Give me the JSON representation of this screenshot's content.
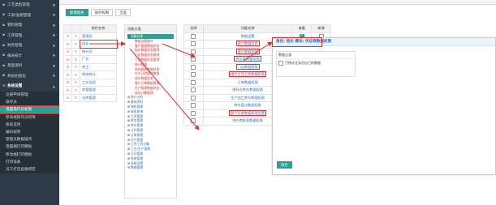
{
  "sidebar": {
    "items": [
      {
        "label": "工艺类别管理",
        "icon": "list-icon"
      },
      {
        "label": "工资/准假管理",
        "icon": "list-icon"
      },
      {
        "label": "物料管理",
        "icon": "box-icon"
      },
      {
        "label": "工序管理",
        "icon": "cog-icon"
      },
      {
        "label": "财务管理",
        "icon": "money-icon"
      },
      {
        "label": "报表统计",
        "icon": "chart-icon"
      },
      {
        "label": "基础资料",
        "icon": "database-icon"
      },
      {
        "label": "系统初始化",
        "icon": "wrench-icon"
      }
    ],
    "settings_label": "系统设置",
    "sub_items": [
      "注册申请管理",
      "操作员",
      "电脑操作员权限",
      "移动端操作员权限",
      "系统选项",
      "编码规则",
      "管理员数据操作",
      "电脑端打印模板",
      "移动端打印模板",
      "打印设备",
      "员工打包设备绑定"
    ],
    "active_sub_index": 2
  },
  "toolbar": {
    "new_label": "新增角色",
    "save_label": "保存权限",
    "all_label": "全选"
  },
  "roles": {
    "header": "角色名称",
    "rows": [
      "管理员",
      "组长",
      "统计员",
      "厂长",
      "质工",
      "财务统计",
      "工艺员组",
      "库管管理",
      "仓库管理"
    ],
    "selected_index": 1
  },
  "categories": {
    "header": "功能分类",
    "nodes": [
      {
        "label": "功能分类",
        "level": 0,
        "selected": true
      },
      {
        "label": "数据设置操作",
        "level": 1
      },
      {
        "label": "客户管理数据状态",
        "level": 1
      },
      {
        "label": "报价数据状态管理",
        "level": 1
      },
      {
        "label": "门店数据状态管理",
        "level": 1
      },
      {
        "label": "工序数据状态管理",
        "level": 1
      },
      {
        "label": "统计数据",
        "level": 1
      },
      {
        "label": "库存管理数据状态",
        "level": 1
      },
      {
        "label": "生产计划操作数据",
        "level": 1
      },
      {
        "label": "成本数据状态",
        "level": 1
      },
      {
        "label": "客户订单数据管理",
        "level": 1
      },
      {
        "label": "生产管理数据状态",
        "level": 1
      },
      {
        "label": "成本计算管理",
        "level": 1
      },
      {
        "label": "统计分析",
        "level": 0
      },
      {
        "label": "基础资料",
        "level": 0
      },
      {
        "label": "物料管理",
        "level": 0
      },
      {
        "label": "报表查询",
        "level": 0
      },
      {
        "label": "工资管理",
        "level": 0
      },
      {
        "label": "财务管理",
        "level": 0
      },
      {
        "label": "库存管理",
        "level": 0
      },
      {
        "label": "计件管理",
        "level": 0
      },
      {
        "label": "订单管理",
        "level": 0
      },
      {
        "label": "生产管理",
        "level": 0
      },
      {
        "label": "工序工资计算",
        "level": 0
      },
      {
        "label": "工艺/生产管理",
        "level": 0
      },
      {
        "label": "打印管理",
        "level": 0
      },
      {
        "label": "系统管理",
        "level": 0
      },
      {
        "label": "系统设置",
        "level": 0
      },
      {
        "label": "数据管理",
        "level": 0
      }
    ]
  },
  "functions": {
    "headers": {
      "select": "选择",
      "name": "功能名称",
      "check": "查看",
      "edit": "新增"
    },
    "rows": [
      {
        "name": "数据设置",
        "selected": false,
        "view": true,
        "highlight": false
      },
      {
        "name": "客户数据状态",
        "selected": false,
        "view": true,
        "highlight": true
      },
      {
        "name": "客户数据权限",
        "selected": false,
        "view": false,
        "highlight": true
      },
      {
        "name": "供应商数据权限",
        "selected": false,
        "view": false,
        "highlight": true
      },
      {
        "name": "门店数据权限",
        "selected": false,
        "view": false,
        "highlight": true
      },
      {
        "name": "操作工序工资数据权限",
        "selected": false,
        "view": true,
        "highlight": true
      },
      {
        "name": "订单数据权限",
        "selected": false,
        "view": false,
        "highlight": false
      },
      {
        "name": "原料仓库存数据权限",
        "selected": false,
        "view": false,
        "highlight": false
      },
      {
        "name": "生产加工库存数据权限",
        "selected": false,
        "view": false,
        "highlight": false
      },
      {
        "name": "库存盘点数据权限",
        "selected": false,
        "view": false,
        "highlight": false
      },
      {
        "name": "客户应收数据权限设置",
        "selected": false,
        "view": true,
        "highlight": true
      },
      {
        "name": "供应商账款数据权限",
        "selected": false,
        "view": false,
        "highlight": false
      }
    ]
  },
  "detail": {
    "title": "角色: 组长    模块: 供应商数据权限",
    "section_title": "数据过滤",
    "option_label": "只统计业务员自己的数据",
    "save_label": "保存"
  },
  "colors": {
    "accent": "#2aa198",
    "sidebar": "#2e3a47",
    "highlight": "#e0302a"
  }
}
